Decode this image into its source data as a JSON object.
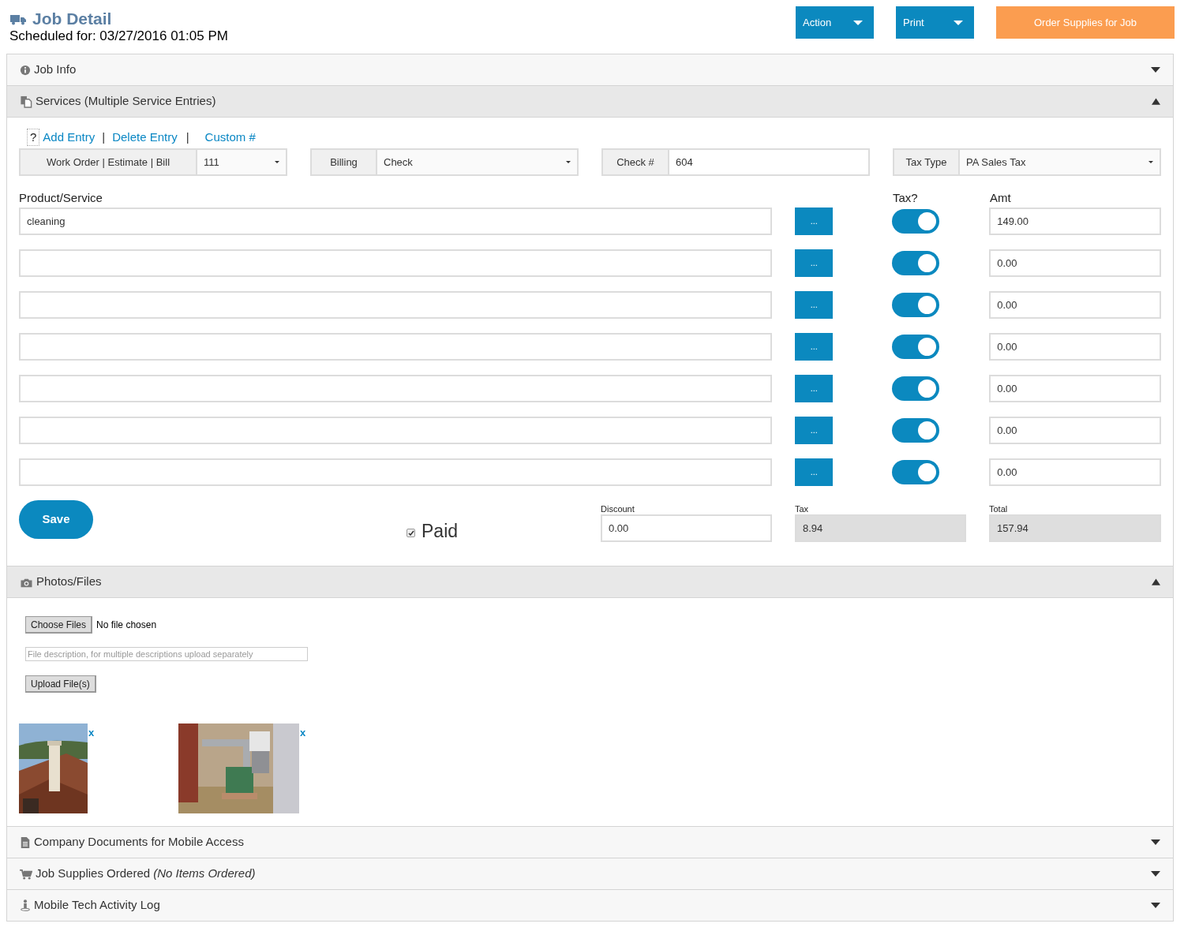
{
  "header": {
    "title": "Job Detail",
    "scheduled": "Scheduled for: 03/27/2016 01:05 PM"
  },
  "actions": [
    {
      "label": "Action",
      "kind": "dropdown"
    },
    {
      "label": "Print",
      "kind": "dropdown"
    },
    {
      "label": "Order Supplies for Job",
      "kind": "accent"
    }
  ],
  "sections": [
    {
      "kind": "info",
      "title": "Job Info",
      "expanded": false
    },
    {
      "kind": "services",
      "title": "Services (Multiple Service Entries)",
      "expanded": true
    },
    {
      "kind": "photos",
      "title": "Photos/Files",
      "expanded": true
    },
    {
      "kind": "documents",
      "title": "Company Documents for Mobile Access",
      "expanded": false
    },
    {
      "kind": "supplies",
      "title": "Job Supplies Ordered *(No Items Ordered)*",
      "expanded": false
    },
    {
      "kind": "log",
      "title": "Mobile Tech Activity Log",
      "expanded": false
    }
  ],
  "services": {
    "help": "?",
    "links": [
      "Add Entry",
      "Delete Entry",
      "Custom #"
    ],
    "separators": [
      "|",
      "|"
    ],
    "fields": [
      {
        "kind": "select",
        "label": "Work Order | Estimate | Bill",
        "value": "111"
      },
      {
        "kind": "select",
        "label": "Billing",
        "value": "Check"
      },
      {
        "kind": "input",
        "label": "Check #",
        "value": "604"
      },
      {
        "kind": "select",
        "label": "Tax Type",
        "value": "PA Sales Tax"
      }
    ],
    "columns": {
      "product": "Product/Service",
      "tax": "Tax?",
      "amount": "Amt"
    },
    "lines": [
      {
        "product": "cleaning",
        "more": "...",
        "taxed": true,
        "amount": "149.00"
      },
      {
        "more": "...",
        "taxed": true,
        "amount": "0.00"
      },
      {
        "more": "...",
        "taxed": true,
        "amount": "0.00"
      },
      {
        "more": "...",
        "taxed": true,
        "amount": "0.00"
      },
      {
        "more": "...",
        "taxed": true,
        "amount": "0.00"
      },
      {
        "more": "...",
        "taxed": true,
        "amount": "0.00"
      },
      {
        "more": "...",
        "taxed": true,
        "amount": "0.00"
      }
    ],
    "save": "Save",
    "paid": {
      "label": "Paid",
      "checked": true
    },
    "totals": [
      {
        "label": "Discount",
        "value": "0.00",
        "readonly": false
      },
      {
        "label": "Tax",
        "value": "8.94",
        "readonly": true
      },
      {
        "label": "Total",
        "value": "157.94",
        "readonly": true
      }
    ]
  },
  "photos": {
    "choose": "Choose Files",
    "file_status": "No file chosen",
    "description": {
      "placeholder": "File description, for multiple descriptions upload separately"
    },
    "upload": "Upload File(s)",
    "images": [
      {
        "kind": "picture",
        "remove": "x"
      },
      {
        "kind": "picture",
        "remove": "x"
      }
    ]
  }
}
